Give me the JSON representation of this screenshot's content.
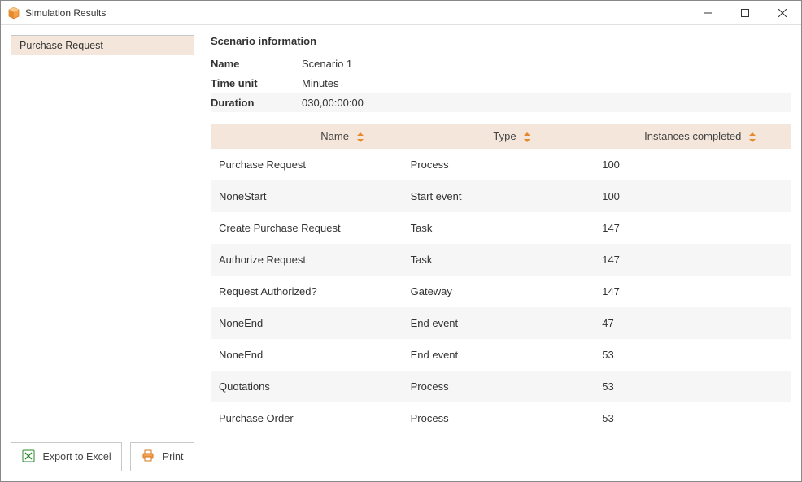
{
  "window": {
    "title": "Simulation Results"
  },
  "sidebar": {
    "items": [
      {
        "label": "Purchase Request"
      }
    ]
  },
  "actions": {
    "export_label": "Export to Excel",
    "print_label": "Print"
  },
  "scenario": {
    "section_title": "Scenario information",
    "name_label": "Name",
    "name_value": "Scenario 1",
    "time_unit_label": "Time unit",
    "time_unit_value": "Minutes",
    "duration_label": "Duration",
    "duration_value": "030,00:00:00"
  },
  "table": {
    "columns": {
      "name": "Name",
      "type": "Type",
      "instances": "Instances completed"
    },
    "rows": [
      {
        "name": "Purchase Request",
        "type": "Process",
        "instances": "100"
      },
      {
        "name": "NoneStart",
        "type": "Start event",
        "instances": "100"
      },
      {
        "name": "Create Purchase Request",
        "type": "Task",
        "instances": "147"
      },
      {
        "name": "Authorize Request",
        "type": "Task",
        "instances": "147"
      },
      {
        "name": "Request Authorized?",
        "type": "Gateway",
        "instances": "147"
      },
      {
        "name": "NoneEnd",
        "type": "End event",
        "instances": "47"
      },
      {
        "name": "NoneEnd",
        "type": "End event",
        "instances": "53"
      },
      {
        "name": "Quotations",
        "type": "Process",
        "instances": "53"
      },
      {
        "name": "Purchase Order",
        "type": "Process",
        "instances": "53"
      }
    ]
  }
}
